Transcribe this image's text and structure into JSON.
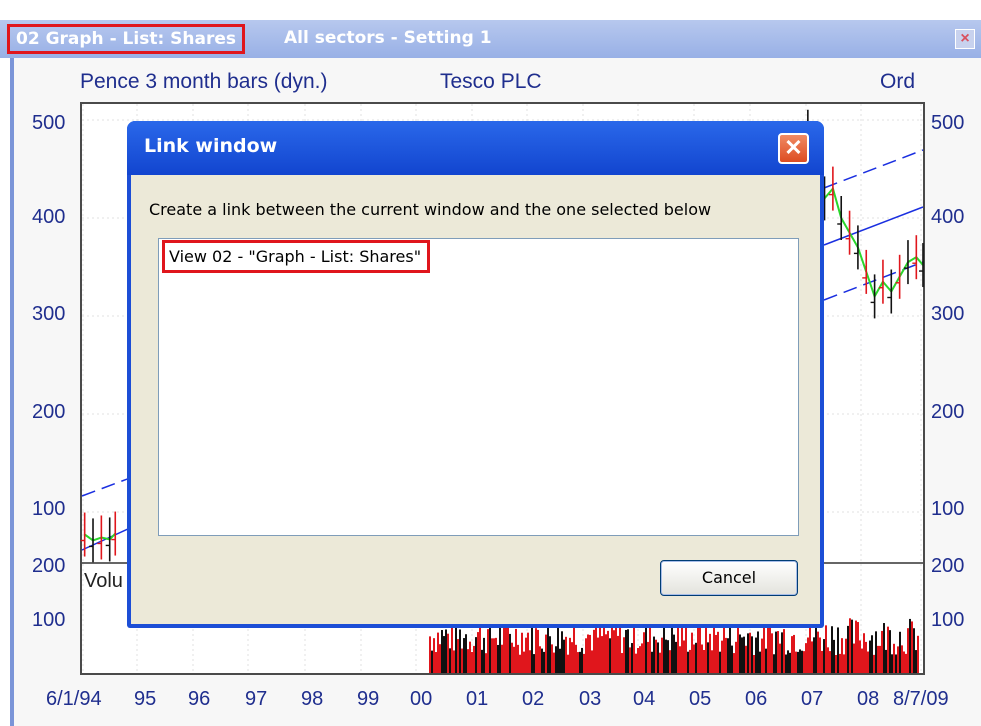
{
  "window": {
    "active_tab": "02 Graph - List: Shares",
    "inactive_tab": "All sectors - Setting 1",
    "close_glyph": "×"
  },
  "chart_header": {
    "left": "Pence 3 month bars (dyn.)",
    "center": "Tesco PLC",
    "right": "Ord"
  },
  "chart_data": {
    "type": "line",
    "title": "Tesco PLC",
    "subtitle": "Pence 3 month bars (dyn.)",
    "y_ticks": [
      "500",
      "400",
      "300",
      "200",
      "100"
    ],
    "volume_ticks": [
      "200",
      "100"
    ],
    "x_ticks": [
      "6/1/94",
      "95",
      "96",
      "97",
      "98",
      "99",
      "00",
      "01",
      "02",
      "03",
      "04",
      "05",
      "06",
      "07",
      "08",
      "8/7/09"
    ],
    "ylim": [
      50,
      510
    ],
    "x_range": [
      "1994-06-01",
      "2009-07-08"
    ],
    "volume_label": "Volu",
    "visible_price_left": [
      {
        "x": 1994.45,
        "y": 77
      },
      {
        "x": 1994.6,
        "y": 71
      },
      {
        "x": 1994.75,
        "y": 74
      },
      {
        "x": 1994.9,
        "y": 72
      },
      {
        "x": 1995.0,
        "y": 78
      }
    ],
    "visible_price_right": [
      {
        "x": 2007.3,
        "y": 470
      },
      {
        "x": 2007.45,
        "y": 488
      },
      {
        "x": 2007.6,
        "y": 455
      },
      {
        "x": 2007.75,
        "y": 420
      },
      {
        "x": 2007.9,
        "y": 430
      },
      {
        "x": 2008.05,
        "y": 400
      },
      {
        "x": 2008.2,
        "y": 385
      },
      {
        "x": 2008.35,
        "y": 370
      },
      {
        "x": 2008.5,
        "y": 345
      },
      {
        "x": 2008.65,
        "y": 320
      },
      {
        "x": 2008.8,
        "y": 335
      },
      {
        "x": 2008.95,
        "y": 325
      },
      {
        "x": 2009.1,
        "y": 340
      },
      {
        "x": 2009.25,
        "y": 355
      },
      {
        "x": 2009.4,
        "y": 360
      },
      {
        "x": 2009.52,
        "y": 352
      }
    ],
    "colors": {
      "axis_text": "#1f2e8e",
      "trend": "#1a2fe0",
      "price": "#2bd62b",
      "up_bar": "#e0161c",
      "volume": "#e0161c"
    },
    "grid": true
  },
  "dialog": {
    "title": "Link window",
    "message": "Create a link between the current window and the one selected below",
    "list_items": [
      "View 02 - \"Graph - List: Shares\""
    ],
    "cancel_label": "Cancel",
    "close_icon": "close-icon"
  },
  "highlight_color": "#e0161c"
}
